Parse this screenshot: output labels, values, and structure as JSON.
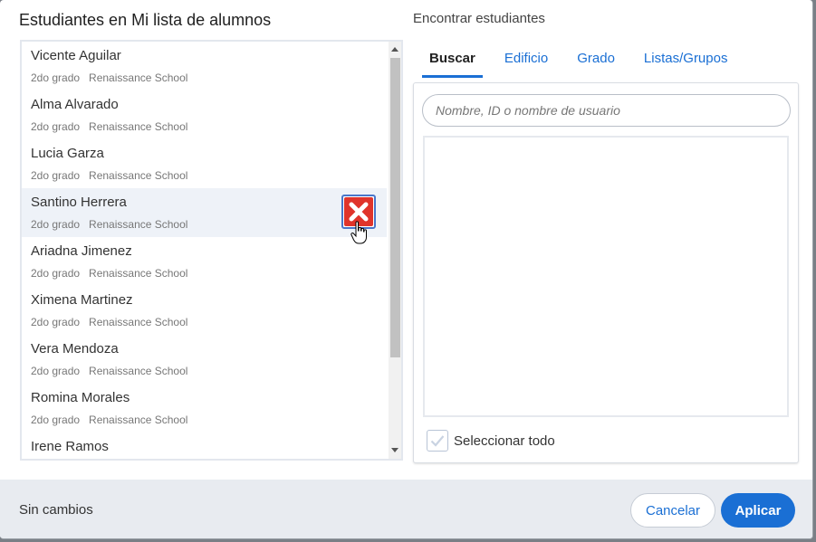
{
  "left_panel": {
    "title": "Estudiantes en Mi lista de alumnos",
    "students": [
      {
        "name": "Vicente Aguilar",
        "grade": "2do grado",
        "school": "Renaissance School"
      },
      {
        "name": "Alma Alvarado",
        "grade": "2do grado",
        "school": "Renaissance School"
      },
      {
        "name": "Lucia Garza",
        "grade": "2do grado",
        "school": "Renaissance School"
      },
      {
        "name": "Santino Herrera",
        "grade": "2do grado",
        "school": "Renaissance School"
      },
      {
        "name": "Ariadna Jimenez",
        "grade": "2do grado",
        "school": "Renaissance School"
      },
      {
        "name": "Ximena Martinez",
        "grade": "2do grado",
        "school": "Renaissance School"
      },
      {
        "name": "Vera Mendoza",
        "grade": "2do grado",
        "school": "Renaissance School"
      },
      {
        "name": "Romina Morales",
        "grade": "2do grado",
        "school": "Renaissance School"
      },
      {
        "name": "Irene Ramos",
        "grade": "2do grado",
        "school": "Renaissance School"
      }
    ],
    "hovered_index": 3,
    "remove_icon": "close-icon",
    "remove_color": "#e0342b"
  },
  "right_panel": {
    "title": "Encontrar estudiantes",
    "tabs": [
      {
        "label": "Buscar",
        "active": true
      },
      {
        "label": "Edificio",
        "active": false
      },
      {
        "label": "Grado",
        "active": false
      },
      {
        "label": "Listas/Grupos",
        "active": false
      }
    ],
    "search": {
      "placeholder": "Nombre, ID o nombre de usuario",
      "value": ""
    },
    "select_all_label": "Seleccionar todo"
  },
  "footer": {
    "status": "Sin cambios",
    "cancel_label": "Cancelar",
    "apply_label": "Aplicar"
  },
  "colors": {
    "accent": "#1a6fd4",
    "hover_row": "#eef2f8",
    "footer_bg": "#e8ebf0"
  }
}
